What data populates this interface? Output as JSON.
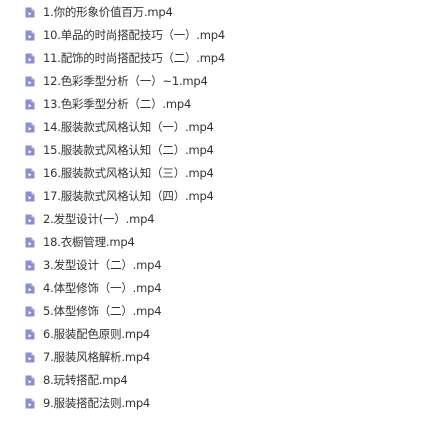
{
  "file_icon": "video-file-icon",
  "icon_color": "#8a8fd4",
  "files": [
    {
      "name": "1.你的形象价值百万.mp4"
    },
    {
      "name": "10.单品的时尚搭配技巧（一）.mp4"
    },
    {
      "name": "11.配饰的时尚搭配技巧（二）.mp4"
    },
    {
      "name": "12.色彩季型分析（一）~1.mp4"
    },
    {
      "name": "13.色彩季型分析（二）.mp4"
    },
    {
      "name": "14.服装款式风格认知（一）.mp4"
    },
    {
      "name": "15.服装款式风格认知（二）.mp4"
    },
    {
      "name": "16.服装款式风格认知（三）.mp4"
    },
    {
      "name": "17.服装款式风格认知（四）.mp4"
    },
    {
      "name": "2.发型设计(一）.mp4"
    },
    {
      "name": "18.衣橱管理.mp4"
    },
    {
      "name": "3.发型设计（二）.mp4"
    },
    {
      "name": "4.体型修饰（一）.mp4"
    },
    {
      "name": "5.体型修饰（二）.mp4"
    },
    {
      "name": "6.服装配色原则.mp4"
    },
    {
      "name": "7.服装风格解析.mp4"
    },
    {
      "name": "8.玩转搭配.mp4"
    },
    {
      "name": "9.服装搭配法则.mp4"
    }
  ]
}
